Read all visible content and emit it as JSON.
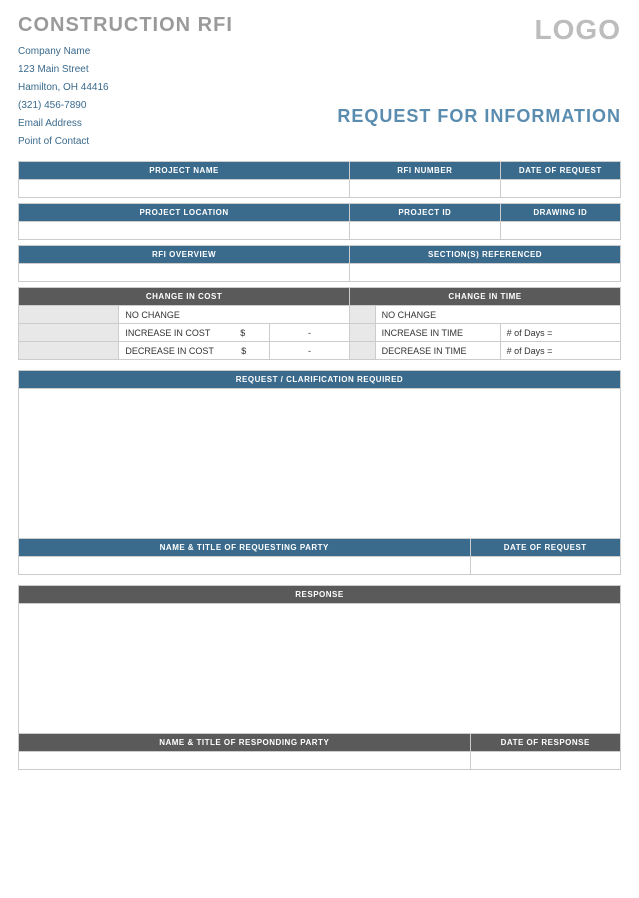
{
  "header": {
    "title": "CONSTRUCTION RFI",
    "logo": "LOGO",
    "company": {
      "name": "Company Name",
      "street": "123 Main Street",
      "city": "Hamilton, OH 44416",
      "phone": "(321) 456-7890",
      "email": "Email Address",
      "contact": "Point of Contact"
    },
    "subtitle": "REQUEST FOR INFORMATION"
  },
  "fields": {
    "project_name": "PROJECT NAME",
    "rfi_number": "RFI NUMBER",
    "date_request": "DATE OF REQUEST",
    "project_location": "PROJECT LOCATION",
    "project_id": "PROJECT ID",
    "drawing_id": "DRAWING ID",
    "rfi_overview": "RFI OVERVIEW",
    "sections_ref": "SECTION(S) REFERENCED",
    "change_cost": "CHANGE IN COST",
    "change_time": "CHANGE IN TIME",
    "no_change": "NO CHANGE",
    "increase_cost": "INCREASE IN COST",
    "decrease_cost": "DECREASE IN COST",
    "increase_time": "INCREASE IN TIME",
    "decrease_time": "DECREASE IN TIME",
    "dollar": "$",
    "dash": "-",
    "days": "# of Days =",
    "request_clarification": "REQUEST / CLARIFICATION REQUIRED",
    "name_title_requesting": "NAME & TITLE OF REQUESTING PARTY",
    "response": "RESPONSE",
    "name_title_responding": "NAME & TITLE OF RESPONDING PARTY",
    "date_response": "DATE OF RESPONSE"
  }
}
